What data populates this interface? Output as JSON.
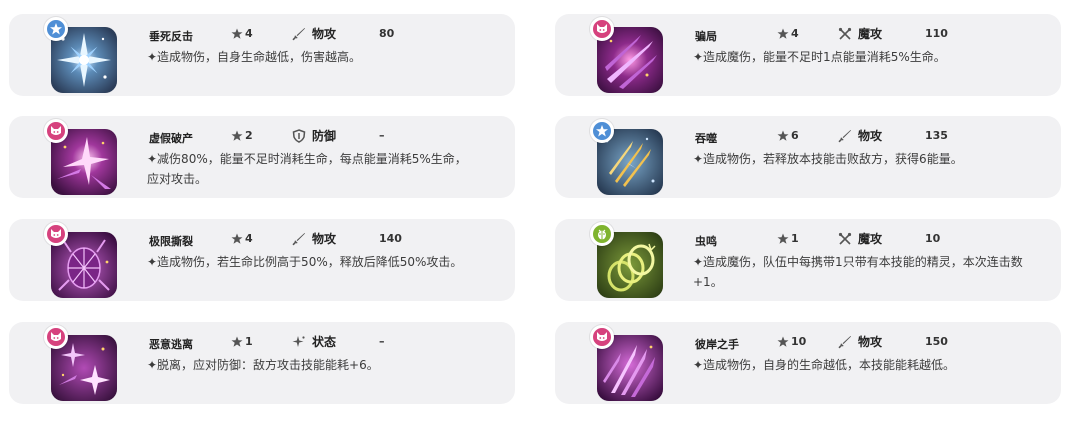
{
  "skills": [
    {
      "name": "垂死反击",
      "cost": "4",
      "type": "物攻",
      "type_icon": "sword-icon",
      "power": "80",
      "badge": "star-badge",
      "badge_color": "#4f8fd6",
      "desc": "✦造成物伤，自身生命越低，伤害越高。",
      "theme": "blue-burst"
    },
    {
      "name": "骗局",
      "cost": "4",
      "type": "魔攻",
      "type_icon": "crossed-wands-icon",
      "power": "110",
      "badge": "cat-badge",
      "badge_color": "#d6427e",
      "desc": "✦造成魔伤，能量不足时1点能量消耗5%生命。",
      "theme": "purple-slash"
    },
    {
      "name": "虚假破产",
      "cost": "2",
      "type": "防御",
      "type_icon": "shield-icon",
      "power": "–",
      "badge": "cat-badge",
      "badge_color": "#d6427e",
      "desc": "✦减伤80%，能量不足时消耗生命，每点能量消耗5%生命，应对攻击。",
      "theme": "purple-burst"
    },
    {
      "name": "吞噬",
      "cost": "6",
      "type": "物攻",
      "type_icon": "sword-icon",
      "power": "135",
      "badge": "star-badge",
      "badge_color": "#4f8fd6",
      "desc": "✦造成物伤，若释放本技能击败敌方，获得6能量。",
      "theme": "blue-claw"
    },
    {
      "name": "极限撕裂",
      "cost": "4",
      "type": "物攻",
      "type_icon": "sword-icon",
      "power": "140",
      "badge": "cat-badge",
      "badge_color": "#d6427e",
      "desc": "✦造成物伤，若生命比例高于50%，释放后降低50%攻击。",
      "theme": "purple-web"
    },
    {
      "name": "虫鸣",
      "cost": "1",
      "type": "魔攻",
      "type_icon": "crossed-wands-icon",
      "power": "10",
      "badge": "bug-badge",
      "badge_color": "#7fb42e",
      "desc": "✦造成魔伤，队伍中每携带1只带有本技能的精灵，本次连击数+1。",
      "theme": "green-rings"
    },
    {
      "name": "恶意逃离",
      "cost": "1",
      "type": "状态",
      "type_icon": "sparkle-icon",
      "power": "–",
      "badge": "cat-badge",
      "badge_color": "#d6427e",
      "desc": "✦脱离，应对防御：敌方攻击技能能耗+6。",
      "theme": "purple-stars"
    },
    {
      "name": "彼岸之手",
      "cost": "10",
      "type": "物攻",
      "type_icon": "sword-icon",
      "power": "150",
      "badge": "cat-badge",
      "badge_color": "#d6427e",
      "desc": "✦造成物伤，自身的生命越低，本技能能耗越低。",
      "theme": "purple-hand"
    }
  ]
}
